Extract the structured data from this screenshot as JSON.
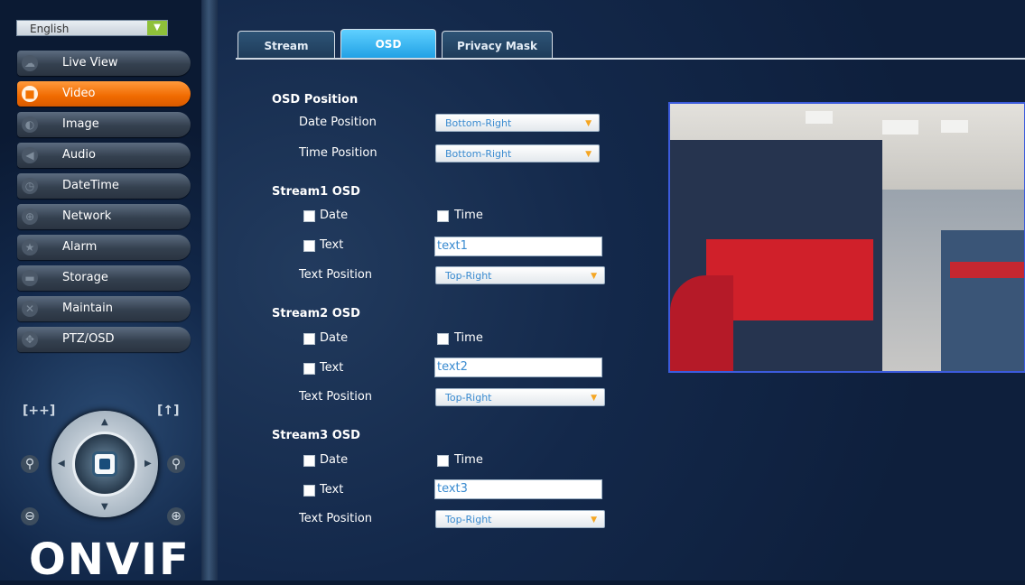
{
  "sidebar": {
    "language": "English",
    "menu": [
      {
        "label": "Live View",
        "icon": "speech-bubble-icon",
        "active": false
      },
      {
        "label": "Video",
        "icon": "video-camera-icon",
        "active": true
      },
      {
        "label": "Image",
        "icon": "image-icon",
        "active": false
      },
      {
        "label": "Audio",
        "icon": "speaker-icon",
        "active": false
      },
      {
        "label": "DateTime",
        "icon": "clock-icon",
        "active": false
      },
      {
        "label": "Network",
        "icon": "globe-icon",
        "active": false
      },
      {
        "label": "Alarm",
        "icon": "alarm-icon",
        "active": false
      },
      {
        "label": "Storage",
        "icon": "storage-icon",
        "active": false
      },
      {
        "label": "Maintain",
        "icon": "tools-icon",
        "active": false
      },
      {
        "label": "PTZ/OSD",
        "icon": "ptz-icon",
        "active": false
      }
    ],
    "ptz": {
      "zoom_fit_label": "[++]",
      "zoom_up_label": "[↑]",
      "logo": "ONVIF"
    }
  },
  "tabs": [
    {
      "label": "Stream",
      "active": false
    },
    {
      "label": "OSD",
      "active": true
    },
    {
      "label": "Privacy Mask",
      "active": false
    }
  ],
  "osd": {
    "osd_position_title": "OSD Position",
    "date_position_label": "Date Position",
    "date_position_value": "Bottom-Right",
    "time_position_label": "Time Position",
    "time_position_value": "Bottom-Right",
    "streams": [
      {
        "title": "Stream1 OSD",
        "date_label": "Date",
        "time_label": "Time",
        "text_label": "Text",
        "text_value": "text1",
        "text_position_label": "Text Position",
        "text_position_value": "Top-Right"
      },
      {
        "title": "Stream2 OSD",
        "date_label": "Date",
        "time_label": "Time",
        "text_label": "Text",
        "text_value": "text2",
        "text_position_label": "Text Position",
        "text_position_value": "Top-Right"
      },
      {
        "title": "Stream3 OSD",
        "date_label": "Date",
        "time_label": "Time",
        "text_label": "Text",
        "text_value": "text3",
        "text_position_label": "Text Position",
        "text_position_value": "Top-Right"
      }
    ]
  },
  "colors": {
    "accent_orange": "#f06a00",
    "tab_active": "#1e9ee3",
    "preview_border": "#3c5bdc"
  }
}
